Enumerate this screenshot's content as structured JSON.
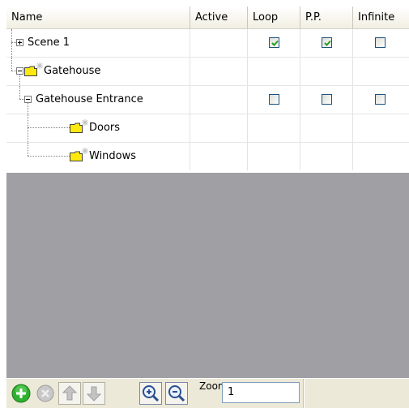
{
  "columns": [
    "Name",
    "Active",
    "Loop",
    "P.P.",
    "Infinite"
  ],
  "rows": [
    {
      "label": "Scene 1",
      "expander": "plus",
      "folder": false,
      "loop": true,
      "pp": true,
      "infinite": false
    },
    {
      "label": "Gatehouse",
      "expander": "minus",
      "folder": true
    },
    {
      "label": "Gatehouse Entrance",
      "expander": "minus",
      "folder": false,
      "loop": false,
      "pp": false,
      "infinite": false
    },
    {
      "label": "Doors",
      "expander": null,
      "folder": true
    },
    {
      "label": "Windows",
      "expander": null,
      "folder": true
    }
  ],
  "toolbar": {
    "buttons": [
      "add-icon",
      "remove-icon",
      "move-up-icon",
      "move-down-icon",
      "zoom-in-icon",
      "zoom-out-icon"
    ],
    "zoom_label": "Zoom:",
    "zoom_value": "1"
  },
  "colors": {
    "check": "#21a121",
    "folder": "#fde910",
    "panel_bg": "#a0a0a4",
    "add_button": "#2fb12f"
  }
}
